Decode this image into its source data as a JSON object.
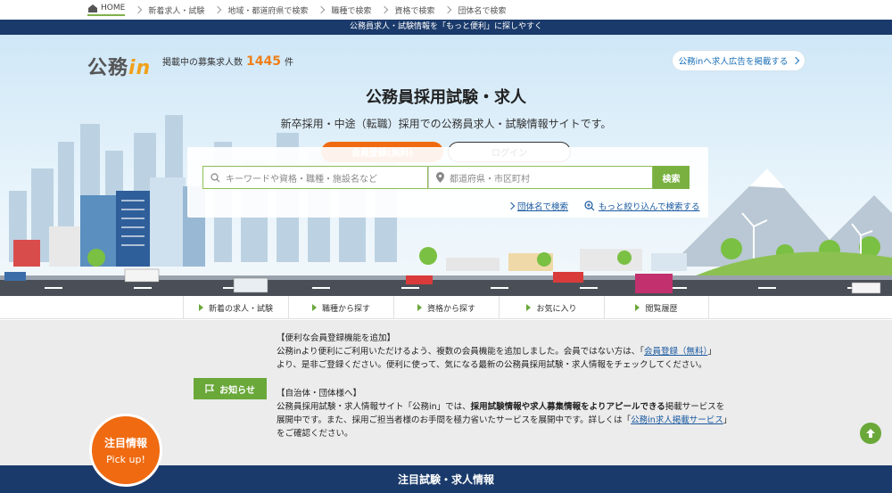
{
  "breadcrumbs": [
    {
      "label": "HOME"
    },
    {
      "label": "新着求人・試験"
    },
    {
      "label": "地域・都道府県で検索"
    },
    {
      "label": "職種で検索"
    },
    {
      "label": "資格で検索"
    },
    {
      "label": "団体名で検索"
    }
  ],
  "tagline": "公務員求人・試験情報を「もっと便利」に探しやすく",
  "header": {
    "logo_text": "公務",
    "logo_in": "in",
    "count_prefix": "掲載中の募集求人数",
    "count_value": "1445",
    "count_suffix": "件",
    "ad_link": "公務inへ求人広告を掲載する"
  },
  "hero": {
    "title": "公務員採用試験・求人",
    "subtitle": "新卒採用・中途（転職）採用での公務員求人・試験情報サイトです。",
    "register_button": "会員登録(無料)",
    "login_button": "ログイン"
  },
  "search": {
    "keyword_placeholder": "キーワードや資格・職種・施設名など",
    "location_placeholder": "都道府県・市区町村",
    "search_button": "検索",
    "org_link": "団体名で検索",
    "refine_link": "もっと絞り込んで検索する"
  },
  "nav": [
    {
      "label": "新着の求人・試験"
    },
    {
      "label": "職種から探す"
    },
    {
      "label": "資格から探す"
    },
    {
      "label": "お気に入り"
    },
    {
      "label": "閲覧履歴"
    }
  ],
  "news": {
    "button_label": "お知らせ",
    "n1_heading": "【便利な会員登録機能を追加】",
    "n1_line1_pre": "公務inより便利にご利用いただけるよう、複数の会員機能を追加しました。会員ではない方は、「",
    "n1_line1_link": "会員登録（無料）",
    "n1_line1_post": "」",
    "n1_line2": "より、是非ご登録ください。便利に使って、気になる最新の公務員採用試験・求人情報をチェックしてください。",
    "n2_heading": "【自治体・団体様へ】",
    "n2_line1_pre": "公務員採用試験・求人情報サイト「公務in」では、",
    "n2_line1_bold": "採用試験情報や求人募集情報をよりアピールできる",
    "n2_line1_post": "掲載サービスを",
    "n2_line2_pre": "展開中です。また、採用ご担当者様のお手間を極力省いたサービスを展開中です。詳しくは「",
    "n2_line2_link": "公務in求人掲載サービス",
    "n2_line2_post": "」",
    "n2_line3": "をご確認ください。"
  },
  "pickup": {
    "line1": "注目情報",
    "line2": "Pick up!"
  },
  "section_title": "注目試験・求人情報",
  "colors": {
    "navy": "#1a3a6b",
    "orange": "#ef6a10",
    "green": "#6aa83a",
    "link": "#1a5aa0"
  }
}
